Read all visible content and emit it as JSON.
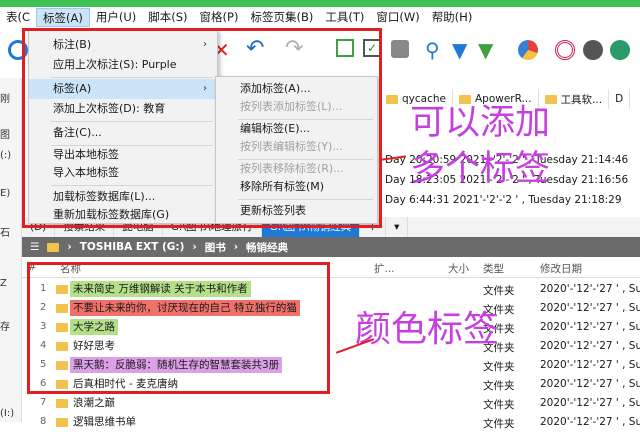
{
  "menubar": {
    "items": [
      "表(C",
      "标签(A)",
      "用户(U)",
      "脚本(S)",
      "窗格(P)",
      "标签页集(B)",
      "工具(T)",
      "窗口(W)",
      "帮助(H)"
    ],
    "active_index": 1
  },
  "left_strip": [
    "刚",
    "图",
    "(:)",
    "E)",
    "石",
    "Z",
    "存",
    "(I:)"
  ],
  "top_tabs": [
    "qycache",
    "ApowerR...",
    "工具软...",
    "D"
  ],
  "top_dates": [
    "Day 20:20:59    2021'-'2'-'2 ' , Tuesday 21:14:46",
    "Day 18:23:05    2021'-'2'-'2 ' , Tuesday 21:16:56",
    "Day 6:44:31    2021'-'2'-'2 ' , Tuesday 21:18:29"
  ],
  "tabbar": [
    "(D)",
    "搜索结果",
    "此电脑",
    "G:\\图书\\地理旅行",
    "G:\\图书\\畅销经典",
    "+",
    "▾"
  ],
  "path": [
    "TOSHIBA EXT (G:)",
    "图书",
    "畅销经典"
  ],
  "columns": {
    "name": "名称",
    "ext": "扩...",
    "size": "大小",
    "type": "类型",
    "date": "修改日期"
  },
  "rows": [
    {
      "num": "1",
      "name": "未来简史 万维钢解读 关于本书和作者",
      "tag": "green",
      "type": "文件夹",
      "date": "2020'-'12'-'27 ' , Sund"
    },
    {
      "num": "2",
      "name": "不要让未来的你，讨厌现在的自己 特立独行的猫",
      "tag": "red",
      "type": "文件夹",
      "date": "2020'-'12'-'27 ' , Sund"
    },
    {
      "num": "3",
      "name": "大学之路",
      "tag": "green",
      "type": "文件夹",
      "date": "2020'-'12'-'27 ' , Sund"
    },
    {
      "num": "4",
      "name": "好好思考",
      "tag": "none",
      "type": "文件夹",
      "date": "2020'-'12'-'27 ' , Sund"
    },
    {
      "num": "5",
      "name": "黑天鹅：反脆弱：随机生存的智慧套装共3册",
      "tag": "purple",
      "type": "文件夹",
      "date": "2020'-'12'-'27 ' , Sund"
    },
    {
      "num": "6",
      "name": "后真相时代 - 麦克唐纳",
      "tag": "none",
      "type": "文件夹",
      "date": "2020'-'12'-'27 ' , Sund"
    },
    {
      "num": "7",
      "name": "浪潮之巅",
      "tag": "none",
      "type": "文件夹",
      "date": "2020'-'12'-'27 ' , Sund"
    },
    {
      "num": "8",
      "name": "逻辑思维书单",
      "tag": "none",
      "type": "文件夹",
      "date": "2020'-'12'-'27 ' , Sund"
    }
  ],
  "tag_colors": {
    "green": "#b5e08a",
    "red": "#f0706a",
    "purple": "#dca0e6",
    "none": "transparent"
  },
  "menu": {
    "items": [
      "标注(B)",
      "应用上次标注(S): Purple",
      "标签(A)",
      "添加上次标签(D): 教育",
      "备注(C)...",
      "导出本地标签",
      "导入本地标签",
      "加载标签数据库(L)...",
      "重新加载标签数据库(G)"
    ]
  },
  "submenu": {
    "items": [
      "添加标签(A)...",
      "按列表添加标签(L)...",
      "编辑标签(E)...",
      "按列表编辑标签(Y)...",
      "按列表移除标签(R)...",
      "移除所有标签(M)",
      "更新标签列表"
    ],
    "disabled": [
      false,
      true,
      false,
      true,
      true,
      false,
      false
    ]
  },
  "callouts": {
    "top": "可以添加\n多个标签",
    "bottom": "颜色标签"
  }
}
